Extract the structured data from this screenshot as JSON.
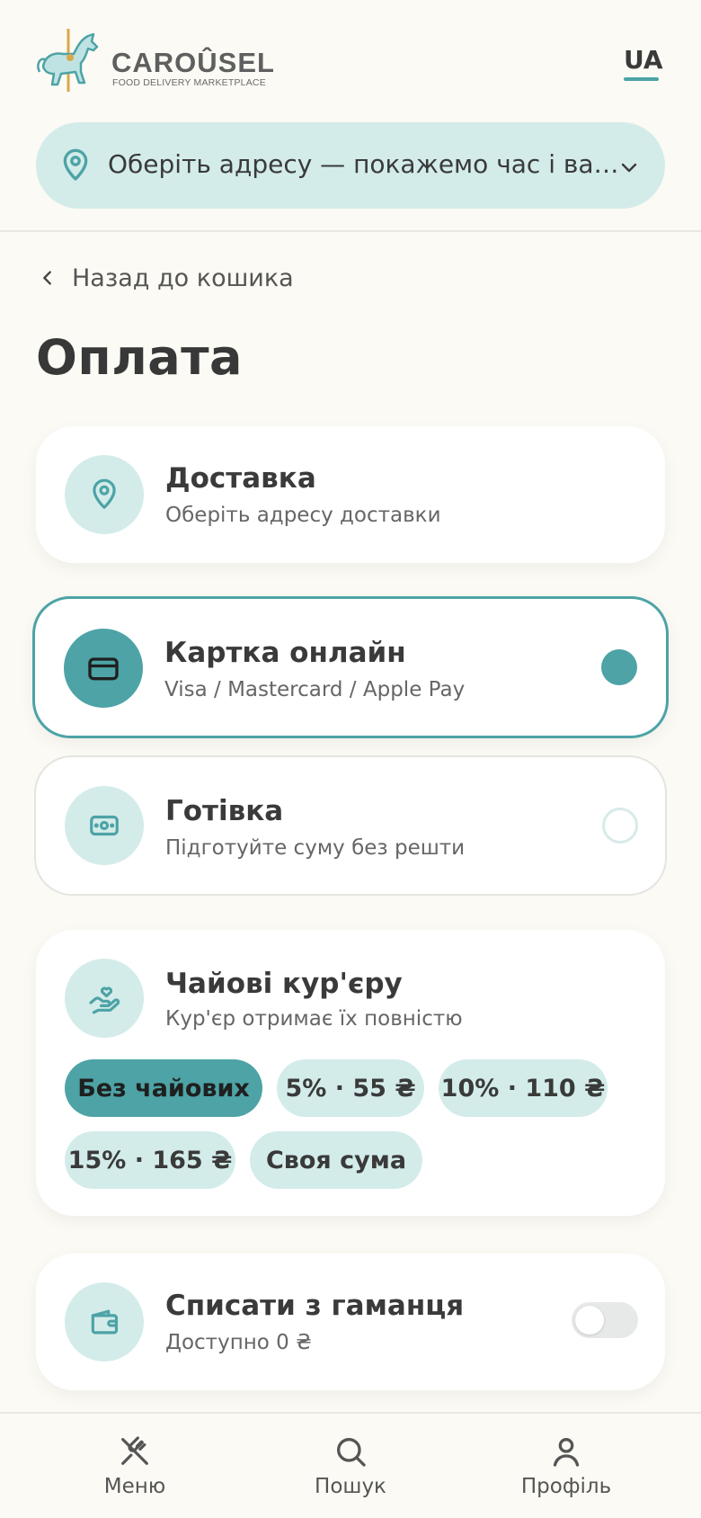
{
  "header": {
    "logo_text": "CAROÛSEL",
    "logo_sub": "FOOD DELIVERY MARKETPLACE",
    "language": "UA",
    "address_placeholder": "Оберіть адресу — покажемо час і вартість",
    "icons": {
      "address": "map-pin-icon",
      "expand": "chevron-down-icon",
      "logo": "carousel-horse-icon"
    }
  },
  "page": {
    "back_label": "Назад до кошика",
    "title": "Оплата"
  },
  "delivery": {
    "title": "Доставка",
    "subtitle": "Оберіть адресу доставки",
    "icon": "map-pin-icon"
  },
  "payment_methods": [
    {
      "title": "Картка онлайн",
      "subtitle": "Visa / Mastercard / Apple Pay",
      "icon": "credit-card-icon",
      "selected": true
    },
    {
      "title": "Готівка",
      "subtitle": "Підготуйте суму без решти",
      "icon": "cash-icon",
      "selected": false
    }
  ],
  "tips": {
    "title": "Чайові кур'єру",
    "subtitle": "Кур'єр отримає їх повністю",
    "icon": "hand-heart-icon",
    "options": [
      "Без чайових",
      "5% · 55 ₴",
      "10% · 110 ₴",
      "15% · 165 ₴",
      "Своя сума"
    ],
    "selected_index": 0
  },
  "wallet": {
    "title": "Списати з гаманця",
    "subtitle": "Доступно 0 ₴",
    "icon": "wallet-icon",
    "enabled": false
  },
  "nav": [
    {
      "label": "Меню",
      "icon": "fork-knife-icon"
    },
    {
      "label": "Пошук",
      "icon": "search-icon"
    },
    {
      "label": "Профіль",
      "icon": "user-icon"
    }
  ],
  "colors": {
    "accent": "#4da3a6",
    "accent_light": "#d3ecea",
    "background": "#fbfaf4"
  }
}
